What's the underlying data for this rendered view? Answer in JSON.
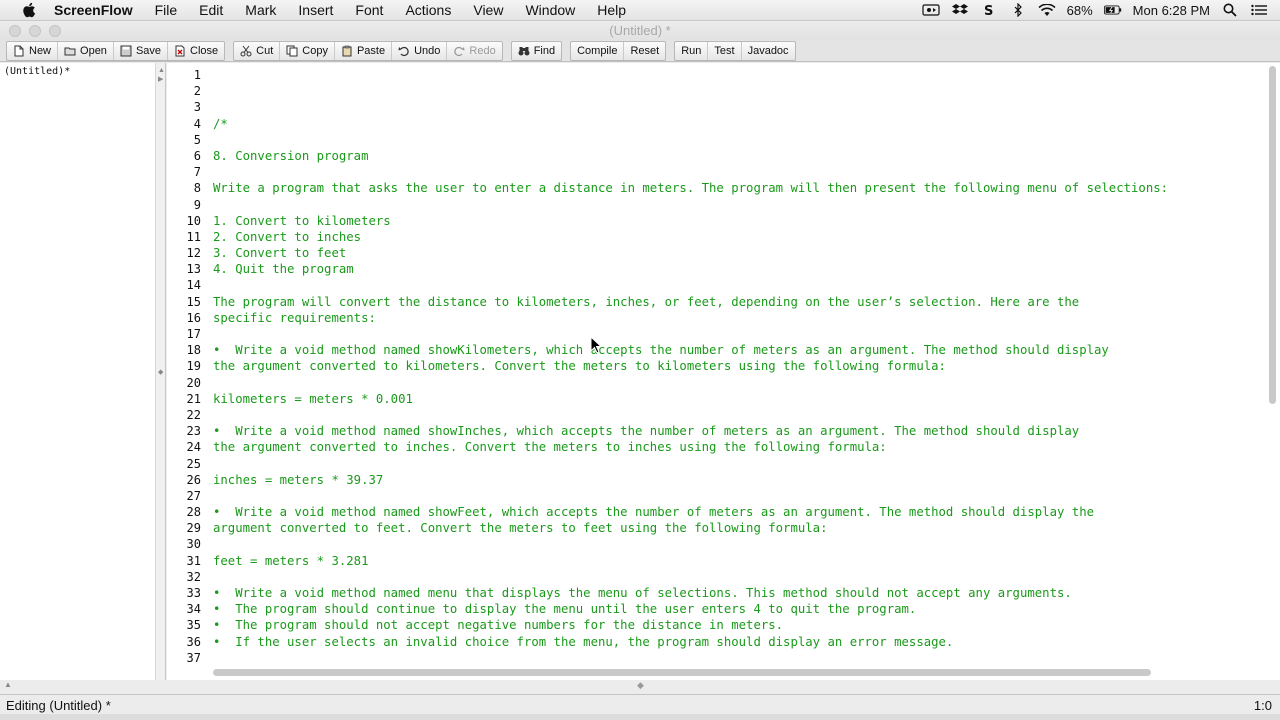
{
  "menubar": {
    "app_name": "ScreenFlow",
    "items": [
      "File",
      "Edit",
      "Mark",
      "Insert",
      "Font",
      "Actions",
      "View",
      "Window",
      "Help"
    ],
    "battery": "68%",
    "clock": "Mon 6:28 PM"
  },
  "window": {
    "title": "(Untitled) *"
  },
  "toolbar": {
    "new": "New",
    "open": "Open",
    "save": "Save",
    "close": "Close",
    "cut": "Cut",
    "copy": "Copy",
    "paste": "Paste",
    "undo": "Undo",
    "redo": "Redo",
    "find": "Find",
    "compile": "Compile",
    "reset": "Reset",
    "run": "Run",
    "test": "Test",
    "javadoc": "Javadoc"
  },
  "files": {
    "current": "(Untitled)*"
  },
  "editor": {
    "line_numbers": [
      "1",
      "2",
      "3",
      "4",
      "5",
      "6",
      "7",
      "8",
      "9",
      "10",
      "11",
      "12",
      "13",
      "14",
      "15",
      "16",
      "17",
      "18",
      "19",
      "20",
      "21",
      "22",
      "23",
      "24",
      "25",
      "26",
      "27",
      "28",
      "29",
      "30",
      "31",
      "32",
      "33",
      "34",
      "35",
      "36",
      "37"
    ],
    "lines": [
      "",
      "",
      "",
      "/*",
      "",
      "8. Conversion program",
      "",
      "Write a program that asks the user to enter a distance in meters. The program will then present the following menu of selections:",
      "",
      "1. Convert to kilometers",
      "2. Convert to inches",
      "3. Convert to feet",
      "4. Quit the program",
      "",
      "The program will convert the distance to kilometers, inches, or feet, depending on the user’s selection. Here are the",
      "specific requirements:",
      "",
      "•  Write a void method named showKilometers, which accepts the number of meters as an argument. The method should display",
      "the argument converted to kilometers. Convert the meters to kilometers using the following formula:",
      "",
      "kilometers = meters * 0.001",
      "",
      "•  Write a void method named showInches, which accepts the number of meters as an argument. The method should display",
      "the argument converted to inches. Convert the meters to inches using the following formula:",
      "",
      "inches = meters * 39.37",
      "",
      "•  Write a void method named showFeet, which accepts the number of meters as an argument. The method should display the",
      "argument converted to feet. Convert the meters to feet using the following formula:",
      "",
      "feet = meters * 3.281",
      "",
      "•  Write a void method named menu that displays the menu of selections. This method should not accept any arguments.",
      "•  The program should continue to display the menu until the user enters 4 to quit the program.",
      "•  The program should not accept negative numbers for the distance in meters.",
      "•  If the user selects an invalid choice from the menu, the program should display an error message.",
      ""
    ]
  },
  "status": {
    "text": "Editing (Untitled) *",
    "position": "1:0"
  }
}
